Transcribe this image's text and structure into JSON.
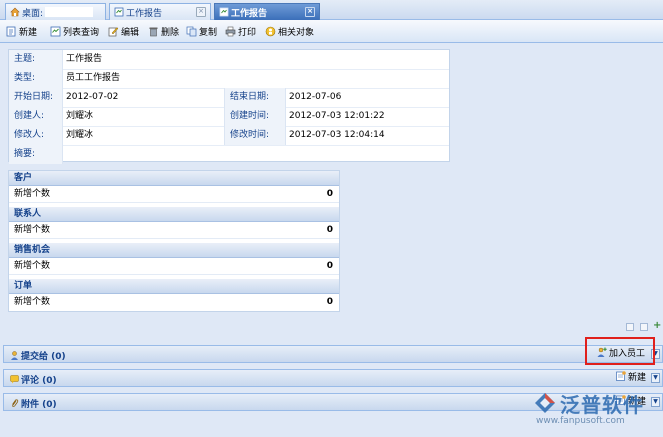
{
  "tabs": [
    {
      "label": "桌面:",
      "active": false
    },
    {
      "label": "工作报告",
      "active": false
    },
    {
      "label": "工作报告",
      "active": true
    }
  ],
  "toolbar": {
    "new": "新建",
    "list_query": "列表查询",
    "edit": "编辑",
    "delete": "删除",
    "copy": "复制",
    "print": "打印",
    "related": "相关对象"
  },
  "form": {
    "subject_label": "主题:",
    "subject": "工作报告",
    "type_label": "类型:",
    "type": "员工工作报告",
    "start_label": "开始日期:",
    "start": "2012-07-02",
    "end_label": "结束日期:",
    "end": "2012-07-06",
    "creator_label": "创建人:",
    "creator": "刘耀冰",
    "created_label": "创建时间:",
    "created": "2012-07-03 12:01:22",
    "modifier_label": "修改人:",
    "modifier": "刘耀冰",
    "modified_label": "修改时间:",
    "modified": "2012-07-03 12:04:14",
    "summary_label": "摘要:",
    "summary": ""
  },
  "stats": [
    {
      "title": "客户",
      "row_label": "新增个数",
      "value": "0"
    },
    {
      "title": "联系人",
      "row_label": "新增个数",
      "value": "0"
    },
    {
      "title": "销售机会",
      "row_label": "新增个数",
      "value": "0"
    },
    {
      "title": "订单",
      "row_label": "新增个数",
      "value": "0"
    }
  ],
  "panels": {
    "submit_to": {
      "title": "提交给 (0)",
      "button": "加入员工"
    },
    "comments": {
      "title": "评论 (0)",
      "button": "新建"
    },
    "attachments": {
      "title": "附件 (0)",
      "button": "新建"
    }
  },
  "watermark": {
    "name": "泛普软件",
    "url": "www.fanpusoft.com"
  },
  "colors": {
    "accent": "#15428b",
    "panel_border": "#99bbe8",
    "highlight": "#e0201c"
  }
}
